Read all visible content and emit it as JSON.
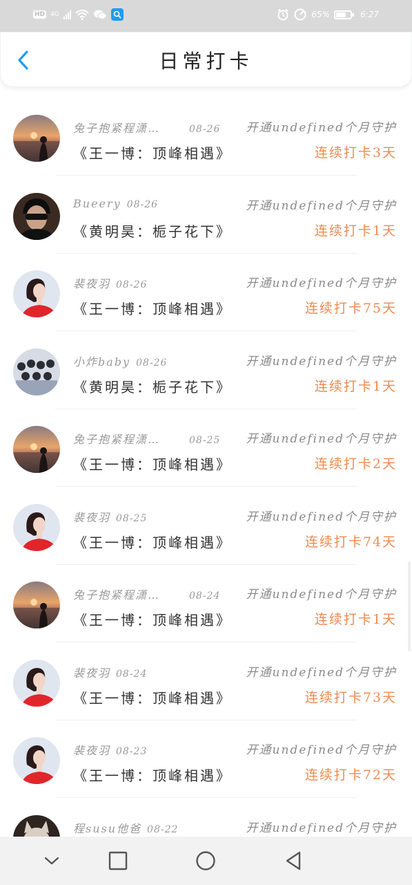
{
  "status_bar": {
    "left_badges": [
      "HD",
      "4G"
    ],
    "battery": "65%",
    "time": "6:27",
    "icons": [
      "signal-icon",
      "wifi-icon",
      "wechat-icon",
      "search-app-icon",
      "alarm-icon",
      "speed-icon",
      "battery-icon"
    ]
  },
  "header": {
    "title": "日常打卡",
    "back_icon": "chevron-left-icon",
    "accent": "#1f9cf0"
  },
  "records": [
    {
      "name": "兔子抱紧程潇…",
      "date": "08-26",
      "book": "《王一博：顶峰相遇》",
      "guard": "开通undefined个月守护",
      "streak": "连续打卡3天",
      "avatar": "sunset"
    },
    {
      "name": "Bueery",
      "date": "08-26",
      "book": "《黄明昊：栀子花下》",
      "guard": "开通undefined个月守护",
      "streak": "连续打卡1天",
      "avatar": "dark-man"
    },
    {
      "name": "裴夜羽",
      "date": "08-26",
      "book": "《王一博：顶峰相遇》",
      "guard": "开通undefined个月守护",
      "streak": "连续打卡75天",
      "avatar": "red-dress"
    },
    {
      "name": "小炸baby",
      "date": "08-26",
      "book": "《黄明昊：栀子花下》",
      "guard": "开通undefined个月守护",
      "streak": "连续打卡1天",
      "avatar": "group"
    },
    {
      "name": "兔子抱紧程潇…",
      "date": "08-25",
      "book": "《王一博：顶峰相遇》",
      "guard": "开通undefined个月守护",
      "streak": "连续打卡2天",
      "avatar": "sunset"
    },
    {
      "name": "裴夜羽",
      "date": "08-25",
      "book": "《王一博：顶峰相遇》",
      "guard": "开通undefined个月守护",
      "streak": "连续打卡74天",
      "avatar": "red-dress"
    },
    {
      "name": "兔子抱紧程潇…",
      "date": "08-24",
      "book": "《王一博：顶峰相遇》",
      "guard": "开通undefined个月守护",
      "streak": "连续打卡1天",
      "avatar": "sunset"
    },
    {
      "name": "裴夜羽",
      "date": "08-24",
      "book": "《王一博：顶峰相遇》",
      "guard": "开通undefined个月守护",
      "streak": "连续打卡73天",
      "avatar": "red-dress"
    },
    {
      "name": "裴夜羽",
      "date": "08-23",
      "book": "《王一博：顶峰相遇》",
      "guard": "开通undefined个月守护",
      "streak": "连续打卡72天",
      "avatar": "red-dress"
    },
    {
      "name": "程susu他爸",
      "date": "08-22",
      "book": "",
      "guard": "开通undefined个月守护",
      "streak": "",
      "avatar": "cat"
    }
  ],
  "colors": {
    "streak": "#ef8a4f",
    "meta": "#9a9a9a",
    "status_bar": "#d9d9d9"
  },
  "nav_bar": {
    "buttons": [
      "nav-down-icon",
      "recent-apps-icon",
      "home-icon",
      "back-triangle-icon"
    ]
  }
}
